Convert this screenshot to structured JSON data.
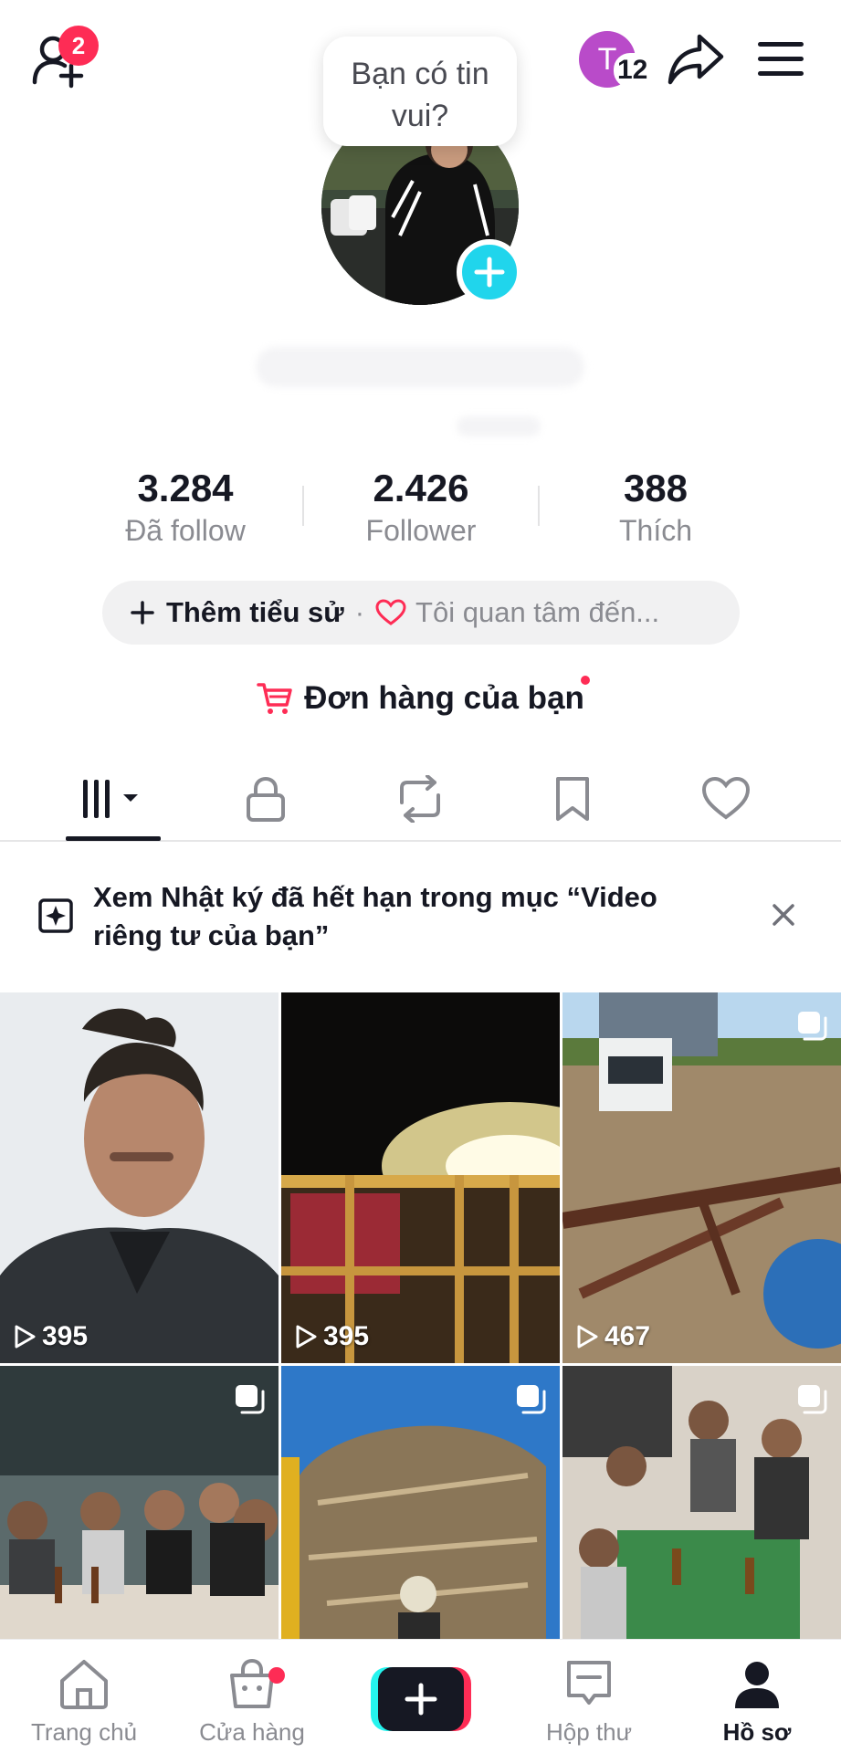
{
  "topbar": {
    "friend_requests_count": "2",
    "note_text": "Bạn có tin vui?",
    "story_avatar_letter": "T",
    "story_count": "12"
  },
  "stats": {
    "following_count": "3.284",
    "following_label": "Đã follow",
    "followers_count": "2.426",
    "followers_label": "Follower",
    "likes_count": "388",
    "likes_label": "Thích"
  },
  "bio": {
    "add_bio_label": "Thêm tiểu sử",
    "separator": "·",
    "interests_label": "Tôi quan tâm đến..."
  },
  "orders": {
    "label": "Đơn hàng của bạn"
  },
  "tabs": [
    "videos",
    "private",
    "reposts",
    "favorites",
    "liked"
  ],
  "banner": {
    "text": "Xem Nhật ký đã hết hạn trong mục “Video riêng tư của bạn”"
  },
  "videos": [
    {
      "views": "395"
    },
    {
      "views": "395"
    },
    {
      "views": "467"
    },
    {
      "views": ""
    },
    {
      "views": ""
    },
    {
      "views": ""
    }
  ],
  "nav": {
    "home": "Trang chủ",
    "shop": "Cửa hàng",
    "inbox": "Hộp thư",
    "profile": "Hồ sơ"
  },
  "colors": {
    "accent_red": "#fe2c55",
    "accent_cyan": "#20d5ec",
    "text_primary": "#161823",
    "text_secondary": "#8a8b91"
  }
}
